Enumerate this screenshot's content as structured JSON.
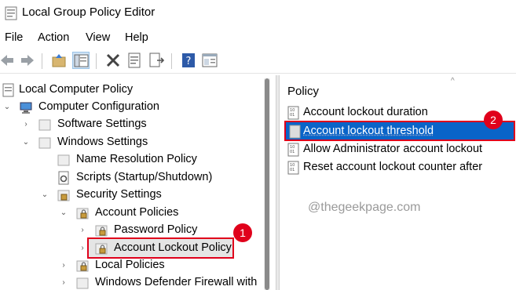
{
  "window": {
    "title": "Local Group Policy Editor"
  },
  "menu": {
    "file": "File",
    "action": "Action",
    "view": "View",
    "help": "Help"
  },
  "toolbar": {
    "buttons": [
      "back-arrow-icon",
      "forward-arrow-icon",
      "up-folder-icon",
      "show-hide-tree-icon",
      "delete-icon",
      "properties-icon",
      "export-list-icon",
      "help-icon",
      "extended-view-icon"
    ]
  },
  "tree": {
    "root": "Local Computer Policy",
    "computer_config": "Computer Configuration",
    "software_settings": "Software Settings",
    "windows_settings": "Windows Settings",
    "name_resolution": "Name Resolution Policy",
    "scripts": "Scripts (Startup/Shutdown)",
    "security_settings": "Security Settings",
    "account_policies": "Account Policies",
    "password_policy": "Password Policy",
    "account_lockout_policy": "Account Lockout Policy",
    "local_policies": "Local Policies",
    "defender_firewall": "Windows Defender Firewall with"
  },
  "list": {
    "column": "Policy",
    "items": [
      "Account lockout duration",
      "Account lockout threshold",
      "Allow Administrator account lockout",
      "Reset account lockout counter after"
    ]
  },
  "annotations": {
    "step1": "1",
    "step2": "2"
  },
  "watermark": "@thegeekpage.com",
  "colors": {
    "selection": "#0a64c8",
    "annotation": "#e0001b"
  }
}
